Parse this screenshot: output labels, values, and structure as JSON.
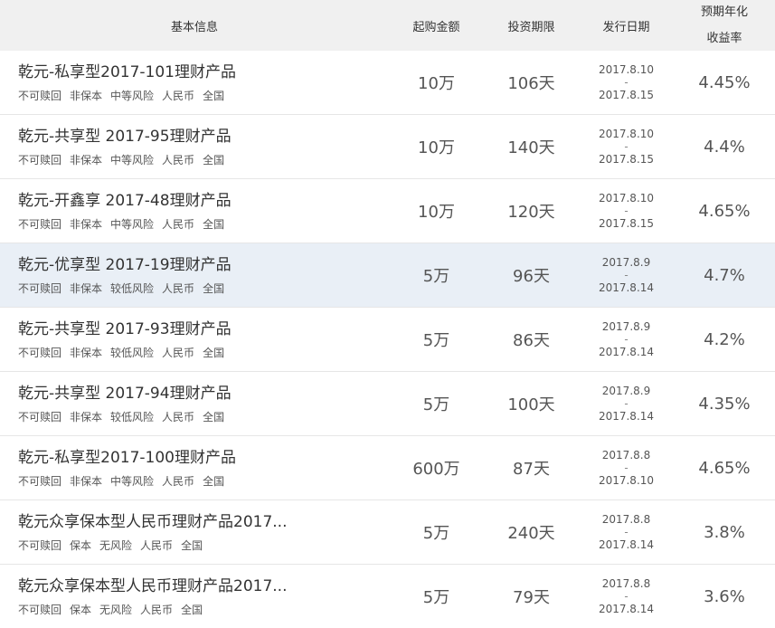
{
  "header": {
    "info": "基本信息",
    "amount": "起购金额",
    "term": "投资期限",
    "date": "发行日期",
    "rate_line1": "预期年化",
    "rate_line2": "收益率"
  },
  "rows": [
    {
      "name": "乾元-私享型2017-101理财产品",
      "tags": [
        "不可赎回",
        "非保本",
        "中等风险",
        "人民币",
        "全国"
      ],
      "amount": "10万",
      "term": "106天",
      "date_start": "2017.8.10",
      "date_sep": "-",
      "date_end": "2017.8.15",
      "rate": "4.45%"
    },
    {
      "name": "乾元-共享型 2017-95理财产品",
      "tags": [
        "不可赎回",
        "非保本",
        "中等风险",
        "人民币",
        "全国"
      ],
      "amount": "10万",
      "term": "140天",
      "date_start": "2017.8.10",
      "date_sep": "-",
      "date_end": "2017.8.15",
      "rate": "4.4%"
    },
    {
      "name": "乾元-开鑫享 2017-48理财产品",
      "tags": [
        "不可赎回",
        "非保本",
        "中等风险",
        "人民币",
        "全国"
      ],
      "amount": "10万",
      "term": "120天",
      "date_start": "2017.8.10",
      "date_sep": "-",
      "date_end": "2017.8.15",
      "rate": "4.65%"
    },
    {
      "name": "乾元-优享型 2017-19理财产品",
      "tags": [
        "不可赎回",
        "非保本",
        "较低风险",
        "人民币",
        "全国"
      ],
      "amount": "5万",
      "term": "96天",
      "date_start": "2017.8.9",
      "date_sep": "-",
      "date_end": "2017.8.14",
      "rate": "4.7%"
    },
    {
      "name": "乾元-共享型 2017-93理财产品",
      "tags": [
        "不可赎回",
        "非保本",
        "较低风险",
        "人民币",
        "全国"
      ],
      "amount": "5万",
      "term": "86天",
      "date_start": "2017.8.9",
      "date_sep": "-",
      "date_end": "2017.8.14",
      "rate": "4.2%"
    },
    {
      "name": "乾元-共享型 2017-94理财产品",
      "tags": [
        "不可赎回",
        "非保本",
        "较低风险",
        "人民币",
        "全国"
      ],
      "amount": "5万",
      "term": "100天",
      "date_start": "2017.8.9",
      "date_sep": "-",
      "date_end": "2017.8.14",
      "rate": "4.35%"
    },
    {
      "name": "乾元-私享型2017-100理财产品",
      "tags": [
        "不可赎回",
        "非保本",
        "中等风险",
        "人民币",
        "全国"
      ],
      "amount": "600万",
      "term": "87天",
      "date_start": "2017.8.8",
      "date_sep": "-",
      "date_end": "2017.8.10",
      "rate": "4.65%"
    },
    {
      "name": "乾元众享保本型人民币理财产品2017...",
      "tags": [
        "不可赎回",
        "保本",
        "无风险",
        "人民币",
        "全国"
      ],
      "amount": "5万",
      "term": "240天",
      "date_start": "2017.8.8",
      "date_sep": "-",
      "date_end": "2017.8.14",
      "rate": "3.8%"
    },
    {
      "name": "乾元众享保本型人民币理财产品2017...",
      "tags": [
        "不可赎回",
        "保本",
        "无风险",
        "人民币",
        "全国"
      ],
      "amount": "5万",
      "term": "79天",
      "date_start": "2017.8.8",
      "date_sep": "-",
      "date_end": "2017.8.14",
      "rate": "3.6%"
    }
  ],
  "highlighted_row": 3,
  "colors": {
    "header_bg": "#f0f0f0",
    "highlight_bg": "#e9eff6",
    "border": "#e6e6e6"
  }
}
